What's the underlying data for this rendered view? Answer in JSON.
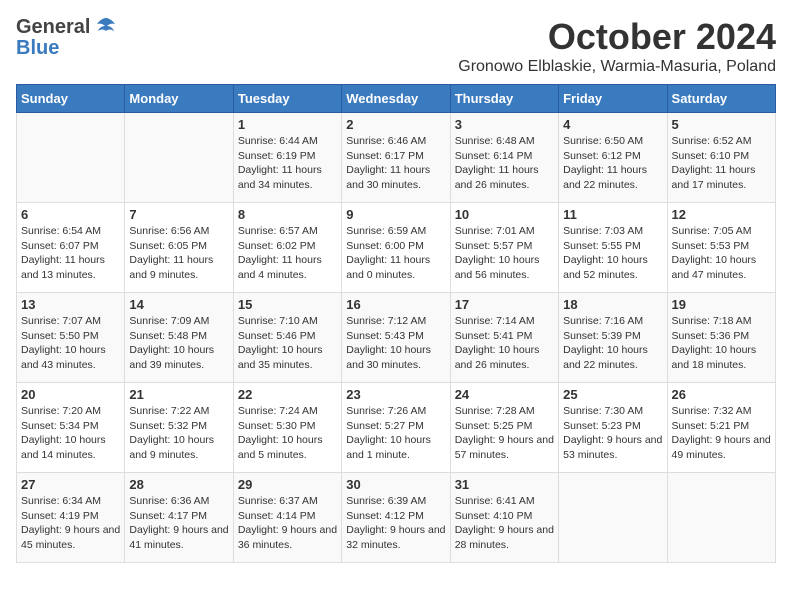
{
  "header": {
    "logo_general": "General",
    "logo_blue": "Blue",
    "title": "October 2024",
    "subtitle": "Gronowo Elblaskie, Warmia-Masuria, Poland"
  },
  "days_of_week": [
    "Sunday",
    "Monday",
    "Tuesday",
    "Wednesday",
    "Thursday",
    "Friday",
    "Saturday"
  ],
  "weeks": [
    [
      {
        "day": "",
        "content": ""
      },
      {
        "day": "",
        "content": ""
      },
      {
        "day": "1",
        "content": "Sunrise: 6:44 AM\nSunset: 6:19 PM\nDaylight: 11 hours and 34 minutes."
      },
      {
        "day": "2",
        "content": "Sunrise: 6:46 AM\nSunset: 6:17 PM\nDaylight: 11 hours and 30 minutes."
      },
      {
        "day": "3",
        "content": "Sunrise: 6:48 AM\nSunset: 6:14 PM\nDaylight: 11 hours and 26 minutes."
      },
      {
        "day": "4",
        "content": "Sunrise: 6:50 AM\nSunset: 6:12 PM\nDaylight: 11 hours and 22 minutes."
      },
      {
        "day": "5",
        "content": "Sunrise: 6:52 AM\nSunset: 6:10 PM\nDaylight: 11 hours and 17 minutes."
      }
    ],
    [
      {
        "day": "6",
        "content": "Sunrise: 6:54 AM\nSunset: 6:07 PM\nDaylight: 11 hours and 13 minutes."
      },
      {
        "day": "7",
        "content": "Sunrise: 6:56 AM\nSunset: 6:05 PM\nDaylight: 11 hours and 9 minutes."
      },
      {
        "day": "8",
        "content": "Sunrise: 6:57 AM\nSunset: 6:02 PM\nDaylight: 11 hours and 4 minutes."
      },
      {
        "day": "9",
        "content": "Sunrise: 6:59 AM\nSunset: 6:00 PM\nDaylight: 11 hours and 0 minutes."
      },
      {
        "day": "10",
        "content": "Sunrise: 7:01 AM\nSunset: 5:57 PM\nDaylight: 10 hours and 56 minutes."
      },
      {
        "day": "11",
        "content": "Sunrise: 7:03 AM\nSunset: 5:55 PM\nDaylight: 10 hours and 52 minutes."
      },
      {
        "day": "12",
        "content": "Sunrise: 7:05 AM\nSunset: 5:53 PM\nDaylight: 10 hours and 47 minutes."
      }
    ],
    [
      {
        "day": "13",
        "content": "Sunrise: 7:07 AM\nSunset: 5:50 PM\nDaylight: 10 hours and 43 minutes."
      },
      {
        "day": "14",
        "content": "Sunrise: 7:09 AM\nSunset: 5:48 PM\nDaylight: 10 hours and 39 minutes."
      },
      {
        "day": "15",
        "content": "Sunrise: 7:10 AM\nSunset: 5:46 PM\nDaylight: 10 hours and 35 minutes."
      },
      {
        "day": "16",
        "content": "Sunrise: 7:12 AM\nSunset: 5:43 PM\nDaylight: 10 hours and 30 minutes."
      },
      {
        "day": "17",
        "content": "Sunrise: 7:14 AM\nSunset: 5:41 PM\nDaylight: 10 hours and 26 minutes."
      },
      {
        "day": "18",
        "content": "Sunrise: 7:16 AM\nSunset: 5:39 PM\nDaylight: 10 hours and 22 minutes."
      },
      {
        "day": "19",
        "content": "Sunrise: 7:18 AM\nSunset: 5:36 PM\nDaylight: 10 hours and 18 minutes."
      }
    ],
    [
      {
        "day": "20",
        "content": "Sunrise: 7:20 AM\nSunset: 5:34 PM\nDaylight: 10 hours and 14 minutes."
      },
      {
        "day": "21",
        "content": "Sunrise: 7:22 AM\nSunset: 5:32 PM\nDaylight: 10 hours and 9 minutes."
      },
      {
        "day": "22",
        "content": "Sunrise: 7:24 AM\nSunset: 5:30 PM\nDaylight: 10 hours and 5 minutes."
      },
      {
        "day": "23",
        "content": "Sunrise: 7:26 AM\nSunset: 5:27 PM\nDaylight: 10 hours and 1 minute."
      },
      {
        "day": "24",
        "content": "Sunrise: 7:28 AM\nSunset: 5:25 PM\nDaylight: 9 hours and 57 minutes."
      },
      {
        "day": "25",
        "content": "Sunrise: 7:30 AM\nSunset: 5:23 PM\nDaylight: 9 hours and 53 minutes."
      },
      {
        "day": "26",
        "content": "Sunrise: 7:32 AM\nSunset: 5:21 PM\nDaylight: 9 hours and 49 minutes."
      }
    ],
    [
      {
        "day": "27",
        "content": "Sunrise: 6:34 AM\nSunset: 4:19 PM\nDaylight: 9 hours and 45 minutes."
      },
      {
        "day": "28",
        "content": "Sunrise: 6:36 AM\nSunset: 4:17 PM\nDaylight: 9 hours and 41 minutes."
      },
      {
        "day": "29",
        "content": "Sunrise: 6:37 AM\nSunset: 4:14 PM\nDaylight: 9 hours and 36 minutes."
      },
      {
        "day": "30",
        "content": "Sunrise: 6:39 AM\nSunset: 4:12 PM\nDaylight: 9 hours and 32 minutes."
      },
      {
        "day": "31",
        "content": "Sunrise: 6:41 AM\nSunset: 4:10 PM\nDaylight: 9 hours and 28 minutes."
      },
      {
        "day": "",
        "content": ""
      },
      {
        "day": "",
        "content": ""
      }
    ]
  ]
}
